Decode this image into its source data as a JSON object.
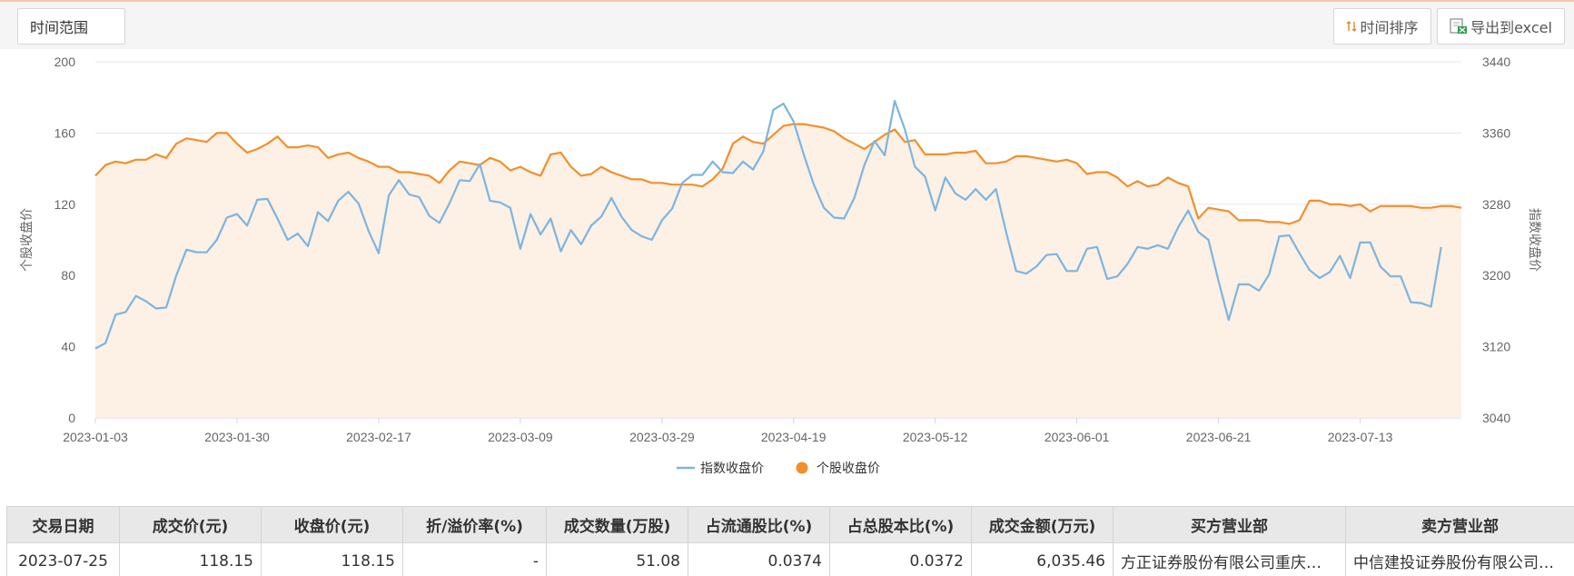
{
  "toolbar": {
    "range_label": "时间范围",
    "sort_label": "时间排序",
    "export_label": "导出到excel"
  },
  "icons": {
    "sort": "sort-arrows-icon",
    "export": "excel-export-icon"
  },
  "colors": {
    "index_line": "#7cb5e0",
    "stock_line": "#f2902b",
    "stock_fill": "#fdeee2"
  },
  "chart_data": {
    "type": "line",
    "left_axis": {
      "label": "个股收盘价",
      "ticks": [
        "200",
        "160",
        "120",
        "80",
        "40",
        "0"
      ],
      "range": [
        0,
        200
      ]
    },
    "right_axis": {
      "label": "指数收盘价",
      "ticks": [
        "3440",
        "3360",
        "3280",
        "3200",
        "3120",
        "3040"
      ],
      "range": [
        3040,
        3440
      ]
    },
    "x_tick_labels": [
      "2023-01-03",
      "2023-01-30",
      "2023-02-17",
      "2023-03-09",
      "2023-03-29",
      "2023-04-19",
      "2023-05-12",
      "2023-06-01",
      "2023-06-21",
      "2023-07-13"
    ],
    "grid": true,
    "legend_position": "bottom-center",
    "series": [
      {
        "name": "指数收盘价",
        "axis": "right",
        "values": [
          3118,
          3124,
          3156,
          3159,
          3177,
          3171,
          3163,
          3164,
          3200,
          3229,
          3226,
          3226,
          3240,
          3265,
          3269,
          3256,
          3285,
          3286,
          3264,
          3240,
          3247,
          3233,
          3271,
          3261,
          3284,
          3294,
          3281,
          3250,
          3225,
          3290,
          3307,
          3291,
          3288,
          3267,
          3259,
          3281,
          3307,
          3306,
          3325,
          3284,
          3282,
          3276,
          3230,
          3269,
          3246,
          3264,
          3227,
          3251,
          3235,
          3256,
          3266,
          3287,
          3266,
          3251,
          3244,
          3240,
          3262,
          3275,
          3304,
          3313,
          3313,
          3328,
          3316,
          3315,
          3328,
          3319,
          3339,
          3386,
          3393,
          3373,
          3336,
          3302,
          3276,
          3265,
          3264,
          3287,
          3324,
          3351,
          3335,
          3396,
          3364,
          3322,
          3311,
          3273,
          3310,
          3292,
          3285,
          3297,
          3285,
          3297,
          3249,
          3205,
          3202,
          3210,
          3223,
          3224,
          3205,
          3205,
          3230,
          3232,
          3196,
          3199,
          3213,
          3232,
          3230,
          3234,
          3230,
          3254,
          3273,
          3249,
          3240,
          3194,
          3150,
          3190,
          3190,
          3183,
          3201,
          3244,
          3245,
          3225,
          3206,
          3197,
          3204,
          3222,
          3197,
          3237,
          3237,
          3210,
          3199,
          3199,
          3170,
          3169,
          3165,
          3232
        ]
      },
      {
        "name": "个股收盘价",
        "axis": "left",
        "values": [
          136,
          142,
          144,
          143,
          145,
          145,
          148,
          146,
          154,
          157,
          156,
          155,
          160,
          160,
          154,
          149,
          151,
          154,
          158,
          152,
          152,
          153,
          152,
          146,
          148,
          149,
          146,
          144,
          141,
          141,
          138,
          138,
          137,
          136,
          132,
          139,
          144,
          143,
          142,
          146,
          144,
          139,
          141,
          138,
          136,
          148,
          149,
          141,
          136,
          137,
          141,
          138,
          136,
          134,
          134,
          132,
          132,
          131,
          131,
          131,
          130,
          134,
          140,
          154,
          158,
          155,
          154,
          159,
          164,
          165,
          165,
          164,
          163,
          161,
          157,
          154,
          151,
          155,
          159,
          162,
          155,
          156,
          148,
          148,
          148,
          149,
          149,
          150,
          143,
          143,
          144,
          147,
          147,
          146,
          145,
          144,
          145,
          143,
          137,
          138,
          138,
          135,
          130,
          133,
          130,
          131,
          135,
          132,
          130,
          112,
          118,
          117,
          116,
          111,
          111,
          111,
          110,
          110,
          109,
          111,
          122,
          122,
          120,
          120,
          119,
          120,
          116,
          119,
          119,
          119,
          119,
          118,
          118,
          119,
          119,
          118
        ]
      }
    ]
  },
  "table": {
    "headers": [
      "交易日期",
      "成交价(元)",
      "收盘价(元)",
      "折/溢价率(%)",
      "成交数量(万股)",
      "占流通股比(%)",
      "占总股本比(%)",
      "成交金额(万元)",
      "买方营业部",
      "卖方营业部"
    ],
    "rows": [
      [
        "2023-07-25",
        "118.15",
        "118.15",
        "-",
        "51.08",
        "0.0374",
        "0.0372",
        "6,035.46",
        "方正证券股份有限公司重庆…",
        "中信建投证券股份有限公司…"
      ]
    ]
  }
}
